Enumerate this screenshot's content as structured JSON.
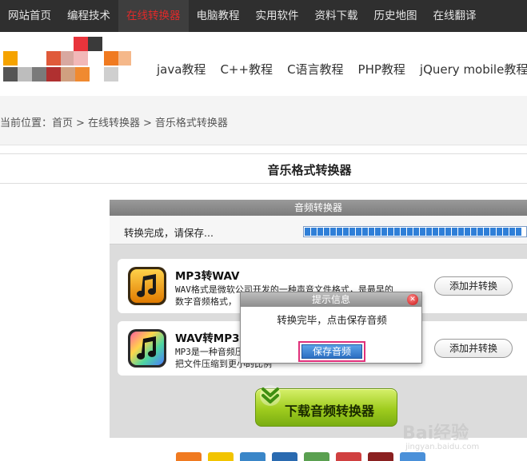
{
  "topnav": {
    "items": [
      {
        "label": "网站首页"
      },
      {
        "label": "编程技术"
      },
      {
        "label": "在线转换器"
      },
      {
        "label": "电脑教程"
      },
      {
        "label": "实用软件"
      },
      {
        "label": "资料下载"
      },
      {
        "label": "历史地图"
      },
      {
        "label": "在线翻译"
      }
    ],
    "active_index": 2,
    "active_color": "#e02a2a"
  },
  "header": {
    "links": [
      "java教程",
      "C++教程",
      "C语言教程",
      "PHP教程",
      "jQuery mobile教程"
    ]
  },
  "breadcrumb": {
    "prefix": "当前位置：",
    "items": [
      "首页",
      "在线转换器",
      "音乐格式转换器"
    ],
    "separator": ">"
  },
  "page": {
    "title": "音乐格式转换器"
  },
  "converter": {
    "header_label": "音频转换器",
    "status_text": "转换完成，请保存...",
    "progress": 1.0,
    "cards": [
      {
        "title": "MP3转WAV",
        "desc_line1": "WAV格式是微软公司开发的一种声音文件格式，是最早的",
        "desc_line2": "数字音频格式，",
        "button": "添加并转换",
        "icon": "music-note-orange-icon"
      },
      {
        "title": "WAV转MP3",
        "desc_line1": "MP3是一种音频压缩技术，它被设计用来大幅度地降低音频数据量，",
        "desc_line2": "把文件压缩到更小的比例",
        "button": "添加并转换",
        "icon": "music-note-rainbow-icon"
      }
    ],
    "download_label": "下载音频转换器"
  },
  "modal": {
    "title": "提示信息",
    "message": "转换完毕，点击保存音频",
    "save_label": "保存音频",
    "highlight_color": "#e0307a"
  },
  "watermark": {
    "text": "Bai经验",
    "sub": "jingyan.baidu.com"
  }
}
